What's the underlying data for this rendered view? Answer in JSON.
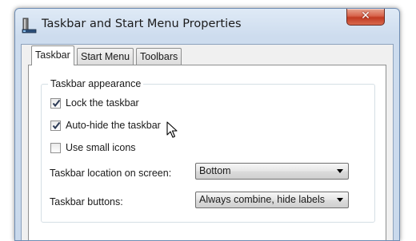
{
  "window": {
    "title": "Taskbar and Start Menu Properties",
    "close_label": "✕"
  },
  "tabs": [
    {
      "label": "Taskbar",
      "active": true
    },
    {
      "label": "Start Menu",
      "active": false
    },
    {
      "label": "Toolbars",
      "active": false
    }
  ],
  "appearance": {
    "legend": "Taskbar appearance",
    "lock": {
      "label": "Lock the taskbar",
      "checked": true
    },
    "autohide": {
      "label": "Auto-hide the taskbar",
      "checked": true
    },
    "small_icons": {
      "label": "Use small icons",
      "checked": false
    },
    "location": {
      "label": "Taskbar location on screen:",
      "value": "Bottom"
    },
    "buttons": {
      "label": "Taskbar buttons:",
      "value": "Always combine, hide labels"
    }
  }
}
